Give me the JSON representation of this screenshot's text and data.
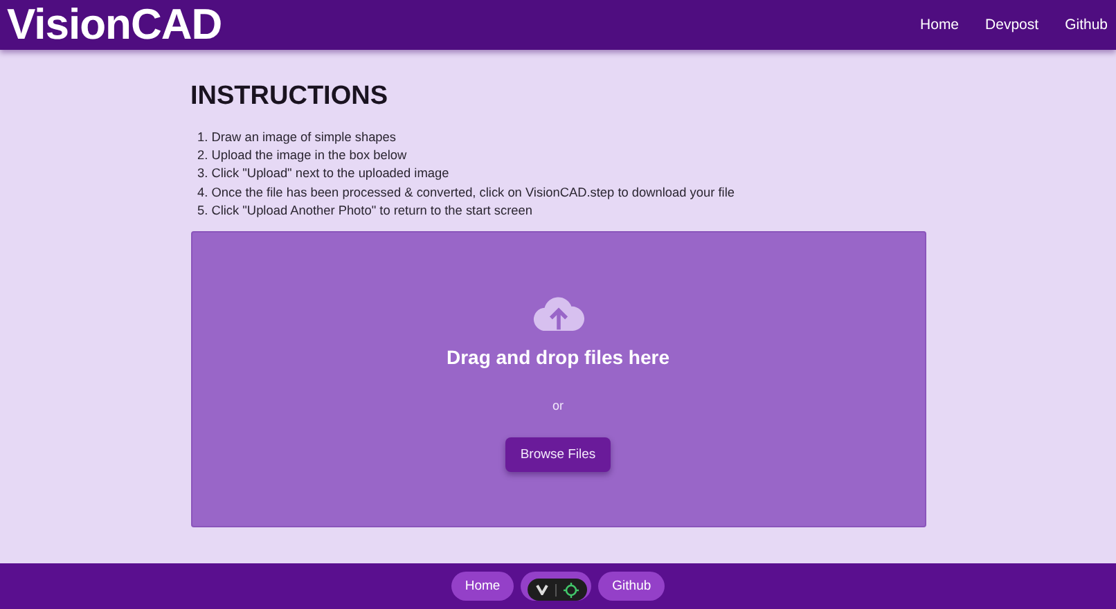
{
  "header": {
    "brand": "VisionCAD",
    "nav": [
      "Home",
      "Devpost",
      "Github"
    ]
  },
  "instructions": {
    "title": "INSTRUCTIONS",
    "steps": [
      "1. Draw an image of simple shapes",
      "2. Upload the image in the box below",
      "3. Click \"Upload\" next to the uploaded image",
      "4. Once the file has been processed & converted, click on VisionCAD.step to download your file",
      "5. Click \"Upload Another Photo\" to return to the start screen"
    ]
  },
  "dropzone": {
    "heading": "Drag and drop files here",
    "separator": "or",
    "button": "Browse Files"
  },
  "footer": {
    "links": [
      {
        "kind": "link",
        "label": "Home"
      },
      {
        "kind": "covered"
      },
      {
        "kind": "link",
        "label": "Github"
      }
    ]
  }
}
